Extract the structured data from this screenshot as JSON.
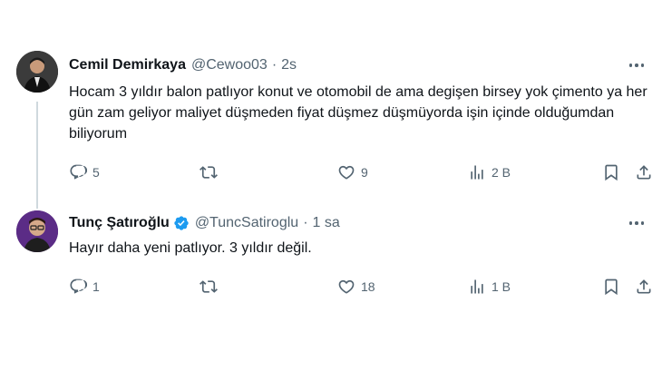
{
  "tweets": [
    {
      "name": "Cemil Demirkaya",
      "handle": "@Cewoo03",
      "time": "2s",
      "text": "Hocam 3 yıldır balon patlıyor konut ve otomobil de ama degişen birsey yok çimento ya her gün zam geliyor maliyet düşmeden fiyat düşmez düşmüyorda işin içinde olduğumdan biliyorum",
      "replies": "5",
      "retweets": "",
      "likes": "9",
      "views": "2 B",
      "verified": false
    },
    {
      "name": "Tunç Şatıroğlu",
      "handle": "@TuncSatiroglu",
      "time": "1 sa",
      "text": "Hayır daha yeni patlıyor. 3 yıldır değil.",
      "replies": "1",
      "retweets": "",
      "likes": "18",
      "views": "1 B",
      "verified": true
    }
  ],
  "colors": {
    "text": "#0f1419",
    "secondary": "#536471",
    "verified": "#1d9bf0",
    "thread_line": "#cfd9de"
  },
  "icons": [
    "reply-icon",
    "retweet-icon",
    "like-icon",
    "views-icon",
    "bookmark-icon",
    "share-icon",
    "more-icon",
    "verified-badge-icon"
  ]
}
